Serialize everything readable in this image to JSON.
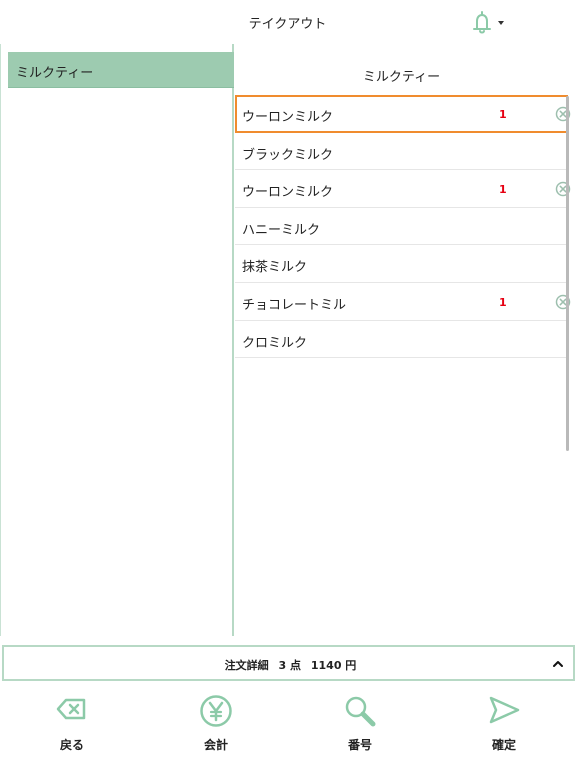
{
  "header": {
    "title": "テイクアウト",
    "bell_icon": "bell-icon"
  },
  "categories": [
    {
      "label": "ミルクティー",
      "selected": true
    }
  ],
  "panel": {
    "title": "ミルクティー",
    "items": [
      {
        "name": "ウーロンミルク",
        "qty": "1",
        "selected": true
      },
      {
        "name": "ブラックミルク",
        "qty": "",
        "selected": false
      },
      {
        "name": "ウーロンミルク",
        "qty": "1",
        "selected": false
      },
      {
        "name": "ハニーミルク",
        "qty": "",
        "selected": false
      },
      {
        "name": "抹茶ミルク",
        "qty": "",
        "selected": false
      },
      {
        "name": "チョコレートミル",
        "qty": "1",
        "selected": false
      },
      {
        "name": "クロミルク",
        "qty": "",
        "selected": false
      }
    ]
  },
  "summary": {
    "label": "注文詳細",
    "count": "3 点",
    "total": "1140 円"
  },
  "nav": {
    "back": "戻る",
    "checkout": "会計",
    "number": "番号",
    "confirm": "確定"
  },
  "colors": {
    "accent_green": "#9dcbb0",
    "icon_green": "#8ccaa8",
    "selection_orange": "#f08c2e",
    "qty_red": "#e60012"
  }
}
